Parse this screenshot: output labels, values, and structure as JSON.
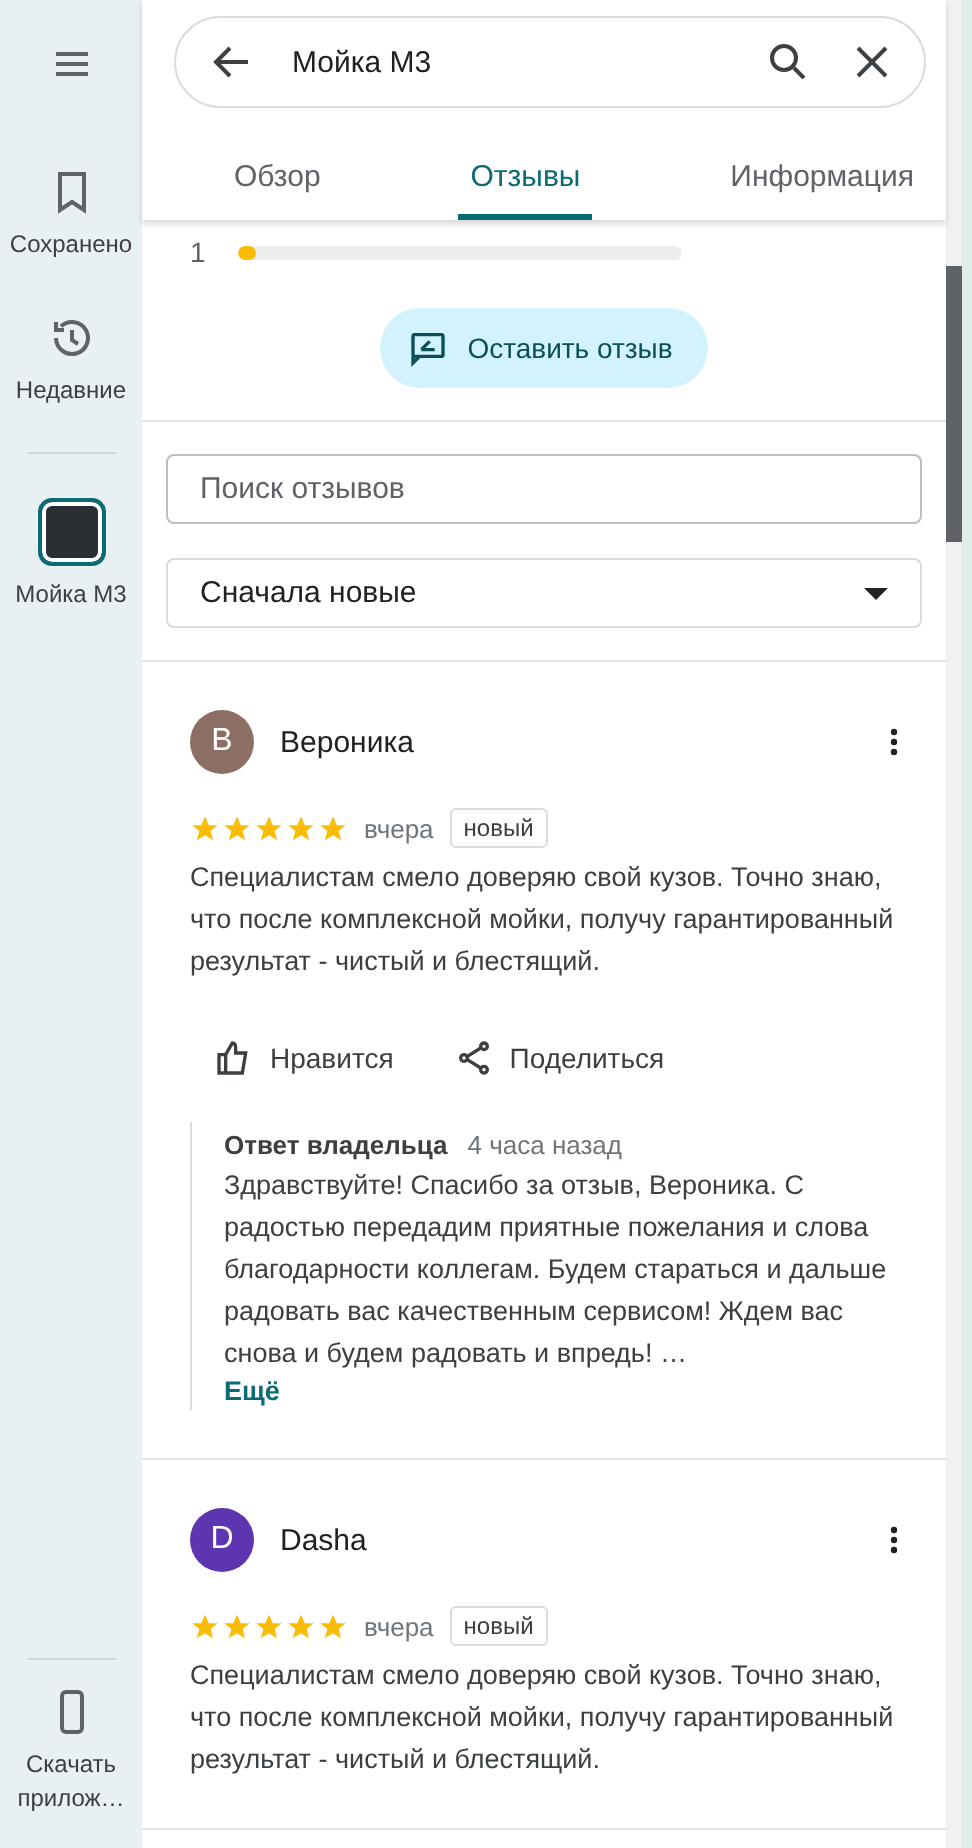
{
  "sidebar": {
    "items": [
      {
        "kind": "saved",
        "label": "Сохранено"
      },
      {
        "kind": "recent",
        "label": "Недавние"
      },
      {
        "kind": "place",
        "label": "Мойка М3",
        "selected": true
      }
    ],
    "footer": {
      "kind": "phone",
      "label": "Скачать прилож…"
    }
  },
  "search": {
    "value": "Мойка М3"
  },
  "tabs": [
    {
      "label": "Обзор",
      "selected": false
    },
    {
      "label": "Отзывы",
      "selected": true
    },
    {
      "label": "Информация",
      "selected": false
    }
  ],
  "rating_bars": [
    {
      "label": "1",
      "level": 0.04
    }
  ],
  "write_review_button": "Оставить отзыв",
  "review_search": {
    "placeholder": "Поиск отзывов"
  },
  "sort": {
    "value": "Сначала новые"
  },
  "reviews": [
    {
      "initial": "В",
      "color": "#8d6e63",
      "author": "Вероника",
      "stars": 5,
      "date": "вчера",
      "badge": "новый",
      "text": "Специалистам смело доверяю свой кузов. Точно знаю, что после комплексной мойки, получу гарантированный результат - чистый и блестящий.",
      "actions": [
        {
          "kind": "like",
          "label": "Нравится"
        },
        {
          "kind": "share",
          "label": "Поделиться"
        }
      ],
      "reply": {
        "title": "Ответ владельца",
        "time": "4 часа назад",
        "text": "Здравствуйте! Спасибо за отзыв, Вероника. С радостью передадим приятные пожелания и слова благодарности коллегам. Будем стараться и дальше радовать вас качественным сервисом! Ждем вас снова и будем радовать и впредь! …",
        "more": "Ещё"
      }
    },
    {
      "initial": "D",
      "color": "#5e35b1",
      "author": "Dasha",
      "stars": 5,
      "date": "вчера",
      "badge": "новый",
      "text": "Специалистам смело доверяю свой кузов. Точно знаю, что после комплексной мойки, получу гарантированный результат - чистый и блестящий."
    }
  ]
}
